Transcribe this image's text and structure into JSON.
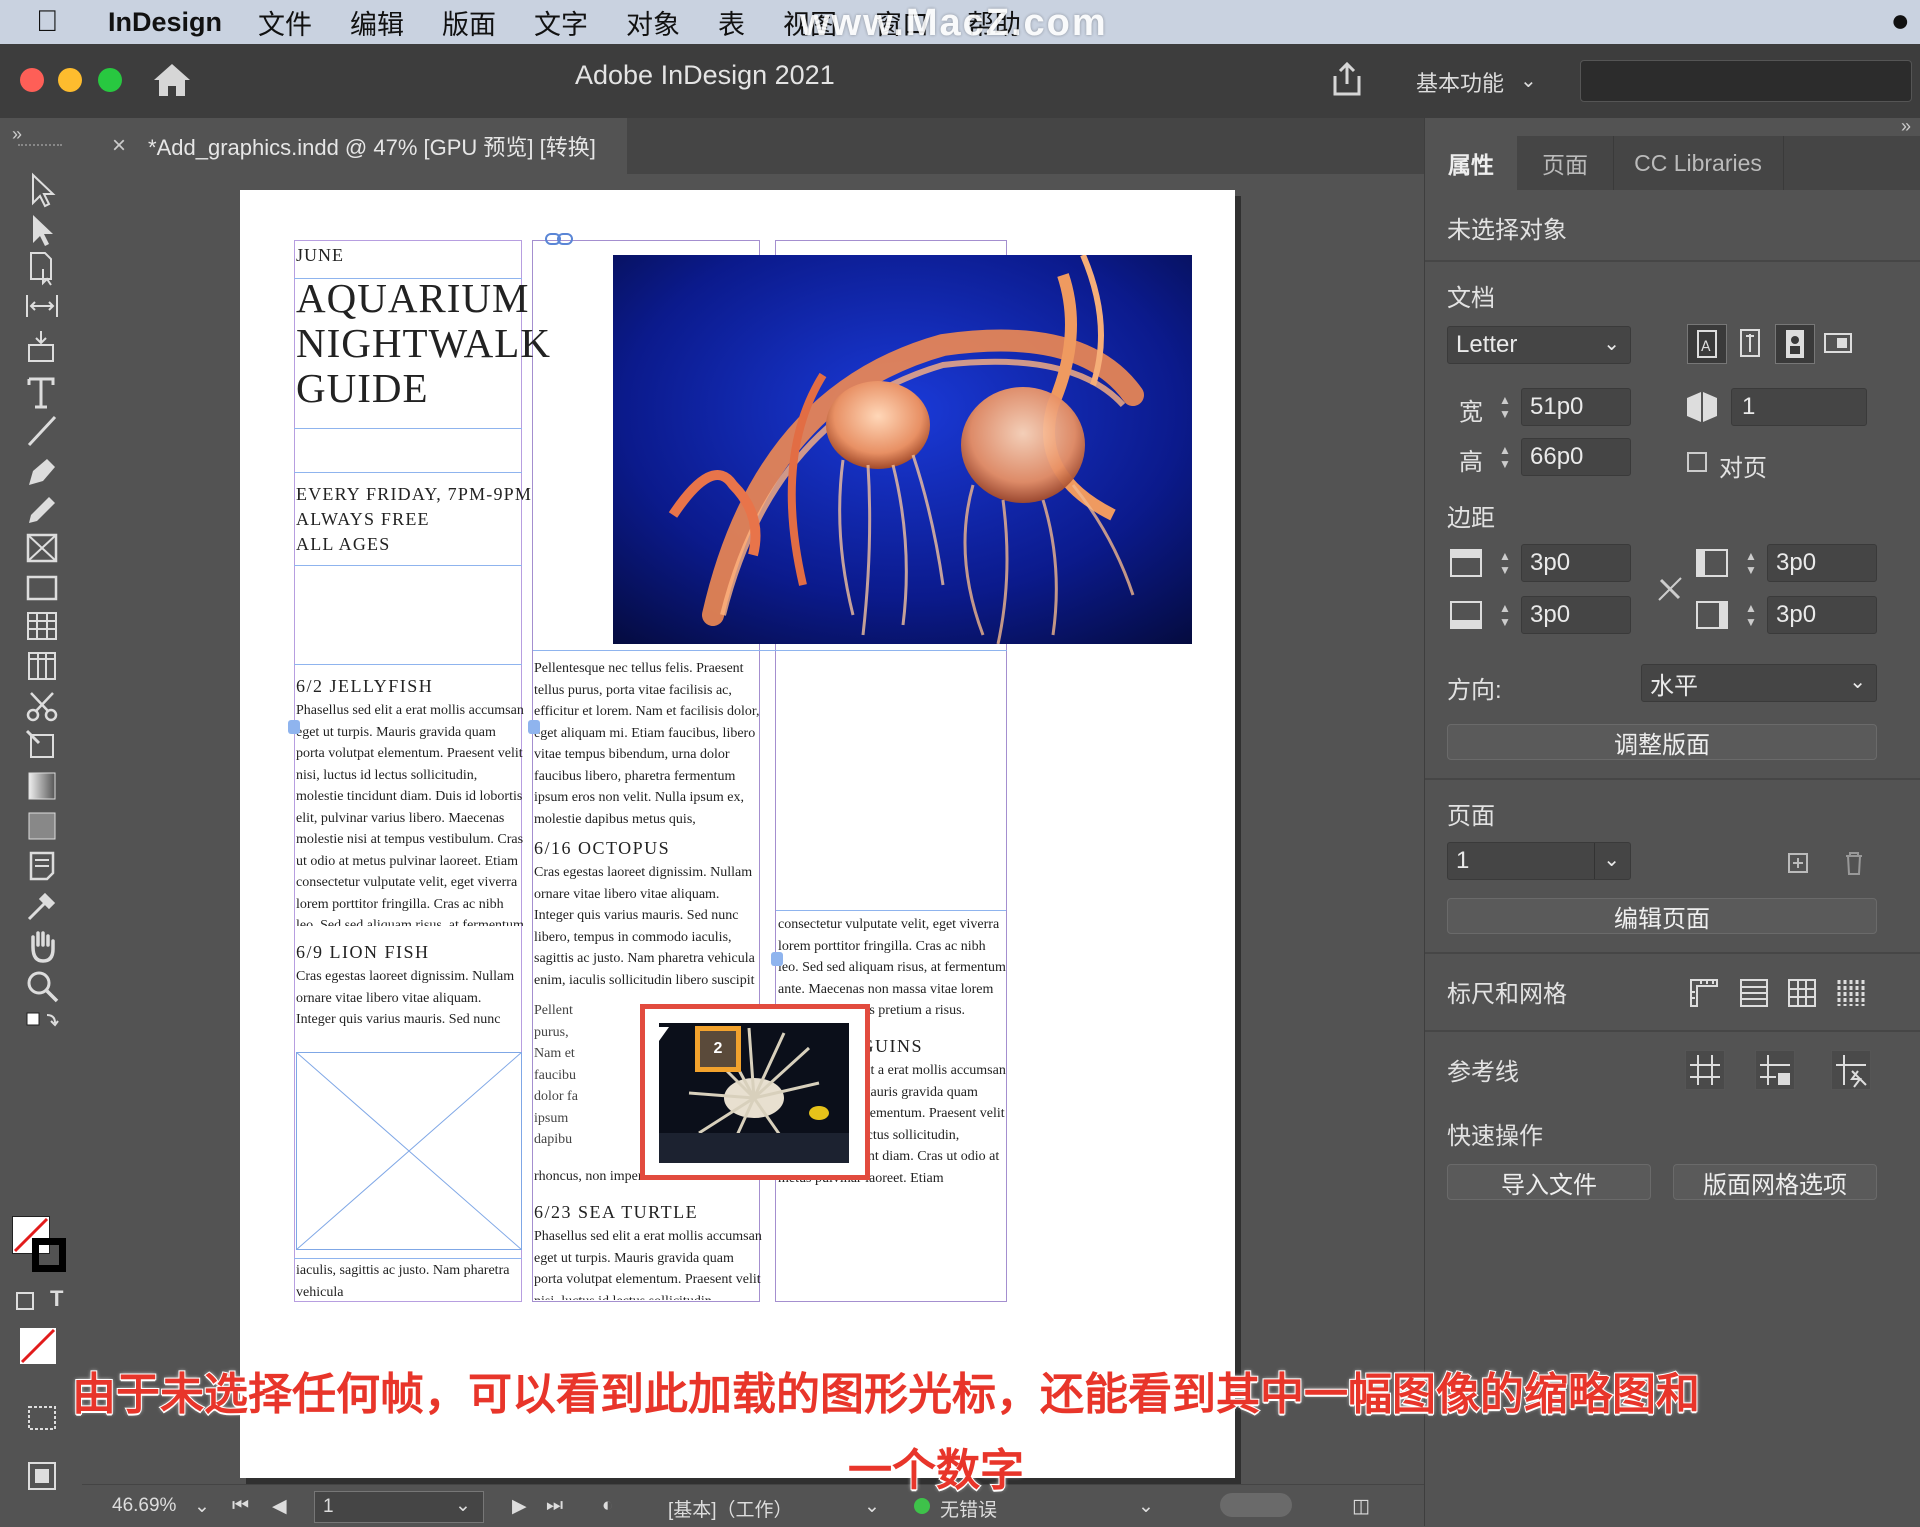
{
  "menubar": {
    "app": "InDesign",
    "items": [
      "文件",
      "编辑",
      "版面",
      "文字",
      "对象",
      "表",
      "视图",
      "窗口",
      "帮助"
    ],
    "watermark": "www.MacZ.com"
  },
  "titlebar": {
    "title": "Adobe InDesign 2021",
    "workspace": "基本功能"
  },
  "document_tab": {
    "label": "*Add_graphics.indd @ 47% [GPU 预览] [转换]"
  },
  "document": {
    "month": "JUNE",
    "title_lines": [
      "AQUARIUM",
      "NIGHTWALK",
      "GUIDE"
    ],
    "info_lines": [
      "EVERY FRIDAY, 7PM-9PM",
      "ALWAYS FREE",
      "ALL AGES"
    ],
    "col1": {
      "head1": "6/2 JELLYFISH",
      "text1": "Phasellus sed elit a erat mollis accumsan eget ut turpis. Mauris gravida quam porta volutpat elementum. Praesent velit nisi, luctus id lectus sollicitudin, molestie tincidunt diam. Duis id lobortis elit, pulvinar varius libero. Maecenas molestie nisi at tempus vestibulum. Cras ut odio at metus pulvinar laoreet. Etiam consectetur vulputate velit, eget viverra lorem porttitor fringilla. Cras ac nibh leo. Sed sed aliquam risus, at fermentum ante. Maecenas non massa vitae lorem malesuada mattis pretium a risus. Vestibulum eget tempor turpis. In sit amet facilisis velit.",
      "head2": "6/9 LION FISH",
      "text2": "Cras egestas laoreet dignissim. Nullam ornare vitae libero vitae aliquam. Integer quis varius mauris. Sed nunc libero, tempus in commodo",
      "text3": "iaculis, sagittis ac justo. Nam pharetra vehicula"
    },
    "col2": {
      "text1": "Pellentesque nec tellus felis. Praesent tellus purus, porta vitae facilisis ac, efficitur et lorem. Nam et facilisis dolor, eget aliquam mi. Etiam faucibus, libero vitae tempus bibendum, urna dolor faucibus libero, pharetra fermentum ipsum eros non velit. Nulla ipsum ex, molestie dapibus metus quis, sollicitudin finibus est. Suspendisse lobortis neque eget sapien rhoncus, non imperdiet orci ultricies.",
      "head1": "6/16 OCTOPUS",
      "text2": "Cras egestas laoreet dignissim. Nullam ornare vitae libero vitae aliquam. Integer quis varius mauris. Sed nunc libero, tempus in commodo iaculis, sagittis ac justo. Nam pharetra vehicula enim, iaculis sollicitudin libero suscipit at. Ut",
      "text3": "rhoncus, non imperdiet orci ultricies.",
      "head2": "6/23 SEA TURTLE",
      "text4": "Phasellus sed elit a erat mollis accumsan eget ut turpis. Mauris gravida quam porta volutpat elementum. Praesent velit nisi, luctus id lectus sollicitudin, molestie tincidunt diam. Duis id lobortis elit, pulvinar varius libero."
    },
    "col3": {
      "text1": "consectetur vulputate velit, eget viverra lorem porttitor fringilla. Cras ac nibh leo. Sed sed aliquam risus, at fermentum ante. Maecenas non massa vitae lorem malesuada mattis pretium a risus. Vestibulum eget tempor turpis. In sit amet facilisis velit.",
      "head1": "6/30 PENGUINS",
      "text2": "Phasellus sed elit a erat mollis accumsan eget ut turpis. Mauris gravida quam porta volutpat elementum. Praesent velit nisi, luctus id lectus sollicitudin, molestie tincidunt diam. Cras ut odio at metus pulvinar laoreet. Etiam consectetur vulputate velit, eget viverra lorem porttitor fringilla. fermentum ante."
    },
    "place_cursor_count": "2"
  },
  "statusbar": {
    "zoom": "46.69%",
    "page": "1",
    "profile": "[基本]（工作）",
    "preflight": "无错误"
  },
  "panel": {
    "tabs": [
      "属性",
      "页面",
      "CC Libraries"
    ],
    "selection": "未选择对象",
    "document_title": "文档",
    "page_size": "Letter",
    "width_label": "宽",
    "width": "51p0",
    "height_label": "高",
    "height": "66p0",
    "pages": "1",
    "facing_label": "对页",
    "margins_title": "边距",
    "margin_top": "3p0",
    "margin_bottom": "3p0",
    "margin_left": "3p0",
    "margin_right": "3p0",
    "orientation_label": "方向:",
    "orientation": "水平",
    "adjust_layout": "调整版面",
    "page_title": "页面",
    "page_value": "1",
    "edit_page": "编辑页面",
    "rulers_grids": "标尺和网格",
    "guides": "参考线",
    "quick_actions": "快速操作",
    "import_file": "导入文件",
    "layout_grid_options": "版面网格选项"
  },
  "subtitle": {
    "line1": "由于未选择任何帧，可以看到此加载的图形光标，还能看到其中一幅图像的缩略图和",
    "line2": "一个数字"
  },
  "colors": {
    "ui_bg": "#535353",
    "subtitle_red": "#e8352a",
    "highlight_red": "#e24b3e",
    "cursor_orange": "#f2a22d"
  }
}
